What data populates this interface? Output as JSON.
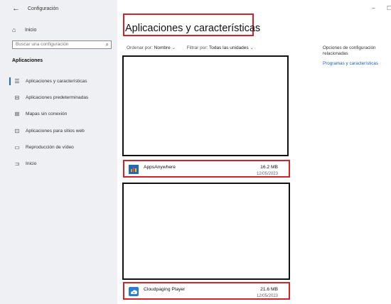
{
  "window": {
    "title": "Configuración",
    "minimize": "–",
    "maximize": "☐"
  },
  "sidebar": {
    "home": "Inicio",
    "search_placeholder": "Buscar una configuración",
    "section": "Aplicaciones",
    "items": [
      {
        "label": "Aplicaciones y características",
        "icon": "apps-features-icon",
        "selected": true
      },
      {
        "label": "Aplicaciones predeterminadas",
        "icon": "default-apps-icon",
        "selected": false
      },
      {
        "label": "Mapas sin conexión",
        "icon": "offline-maps-icon",
        "selected": false
      },
      {
        "label": "Aplicaciones para sitios web",
        "icon": "websites-apps-icon",
        "selected": false
      },
      {
        "label": "Reproducción de vídeo",
        "icon": "video-playback-icon",
        "selected": false
      },
      {
        "label": "Inicio",
        "icon": "startup-icon",
        "selected": false
      }
    ]
  },
  "main": {
    "title": "Aplicaciones y características",
    "sort_label": "Ordenar por:",
    "sort_value": "Nombre",
    "filter_label": "Filtrar por:",
    "filter_value": "Todas las unidades",
    "apps": [
      {
        "name": "AppsAnywhere",
        "size": "16.2 MB",
        "date": "12/05/2023"
      },
      {
        "name": "Cloudpaging Player",
        "size": "21.6 MB",
        "date": "12/05/2023"
      }
    ]
  },
  "related": {
    "heading": "Opciones de configuración relacionadas",
    "link": "Programas y características"
  },
  "colors": {
    "accent": "#1a6fd3",
    "highlight": "#d3222c",
    "sidebar_bg": "#eef0f3"
  }
}
